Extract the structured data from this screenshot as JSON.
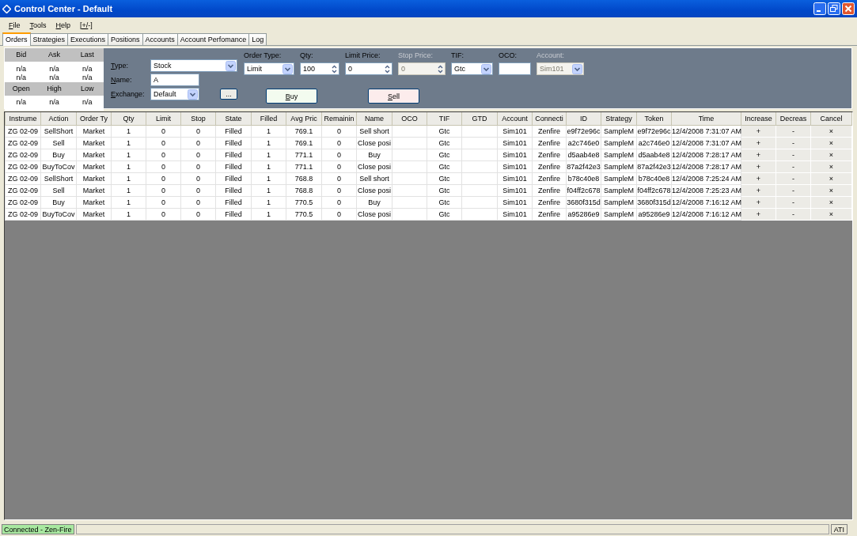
{
  "window": {
    "title": "Control Center - Default"
  },
  "menu": [
    {
      "label": "File"
    },
    {
      "label": "Tools"
    },
    {
      "label": "Help"
    },
    {
      "label": "[+/-]"
    }
  ],
  "tabs": [
    {
      "label": "Orders",
      "selected": true
    },
    {
      "label": "Strategies",
      "selected": false
    },
    {
      "label": "Executions",
      "selected": false
    },
    {
      "label": "Positions",
      "selected": false
    },
    {
      "label": "Accounts",
      "selected": false
    },
    {
      "label": "Account Perfomance",
      "selected": false
    },
    {
      "label": "Log",
      "selected": false
    }
  ],
  "quote": {
    "headers_top": [
      "Bid",
      "Ask",
      "Last"
    ],
    "values_top": [
      [
        "n/a",
        "n/a",
        "n/a"
      ],
      [
        "n/a",
        "n/a",
        "n/a"
      ]
    ],
    "headers_bottom": [
      "Open",
      "High",
      "Low"
    ],
    "values_bottom": [
      "n/a",
      "n/a",
      "n/a"
    ]
  },
  "instrument": [
    {
      "label": "Type:",
      "kind": "dropdown",
      "value": "Stock"
    },
    {
      "label": "Name:",
      "kind": "text",
      "value": "A"
    },
    {
      "label": "Exchange:",
      "kind": "dropdown",
      "value": "Default"
    }
  ],
  "browse_button": "...",
  "order_fields": [
    {
      "label": "Order Type:",
      "kind": "dropdown",
      "value": "Limit",
      "disabled": false
    },
    {
      "label": "Qty:",
      "kind": "spinner",
      "value": "100",
      "disabled": false
    },
    {
      "label": "Limit Price:",
      "kind": "spinner",
      "value": "0",
      "disabled": false
    },
    {
      "label": "Stop Price:",
      "kind": "spinner",
      "value": "0",
      "disabled": true
    },
    {
      "label": "TIF:",
      "kind": "dropdown",
      "value": "Gtc",
      "disabled": false
    },
    {
      "label": "OCO:",
      "kind": "text",
      "disabled": false
    },
    {
      "label": "Account:",
      "kind": "dropdown",
      "value": "Sim101",
      "disabled": true
    }
  ],
  "buttons": [
    {
      "label": "Buy",
      "kind": "buy"
    },
    {
      "label": "Sell",
      "kind": "sell"
    }
  ],
  "table": {
    "columns": [
      "Instrume",
      "Action",
      "Order Ty",
      "Qty",
      "Limit",
      "Stop",
      "State",
      "Filled",
      "Avg Pric",
      "Remainin",
      "Name",
      "OCO",
      "TIF",
      "GTD",
      "Account",
      "Connecti",
      "ID",
      "Strategy",
      "Token",
      "Time",
      "Increase",
      "Decreas",
      "Cancel"
    ],
    "rows": [
      [
        "ZG 02-09",
        "SellShort",
        "Market",
        "1",
        "0",
        "0",
        "Filled",
        "1",
        "769.1",
        "0",
        "Sell short",
        "",
        "Gtc",
        "",
        "Sim101",
        "Zenfire",
        "e9f72e96c",
        "SampleM",
        "e9f72e96c",
        "12/4/2008 7:31:07 AM",
        "+",
        "-",
        "×"
      ],
      [
        "ZG 02-09",
        "Sell",
        "Market",
        "1",
        "0",
        "0",
        "Filled",
        "1",
        "769.1",
        "0",
        "Close posi",
        "",
        "Gtc",
        "",
        "Sim101",
        "Zenfire",
        "a2c746e0",
        "SampleM",
        "a2c746e0",
        "12/4/2008 7:31:07 AM",
        "+",
        "-",
        "×"
      ],
      [
        "ZG 02-09",
        "Buy",
        "Market",
        "1",
        "0",
        "0",
        "Filled",
        "1",
        "771.1",
        "0",
        "Buy",
        "",
        "Gtc",
        "",
        "Sim101",
        "Zenfire",
        "d5aab4e8",
        "SampleM",
        "d5aab4e8",
        "12/4/2008 7:28:17 AM",
        "+",
        "-",
        "×"
      ],
      [
        "ZG 02-09",
        "BuyToCov",
        "Market",
        "1",
        "0",
        "0",
        "Filled",
        "1",
        "771.1",
        "0",
        "Close posi",
        "",
        "Gtc",
        "",
        "Sim101",
        "Zenfire",
        "87a2f42e3",
        "SampleM",
        "87a2f42e3",
        "12/4/2008 7:28:17 AM",
        "+",
        "-",
        "×"
      ],
      [
        "ZG 02-09",
        "SellShort",
        "Market",
        "1",
        "0",
        "0",
        "Filled",
        "1",
        "768.8",
        "0",
        "Sell short",
        "",
        "Gtc",
        "",
        "Sim101",
        "Zenfire",
        "b78c40e8",
        "SampleM",
        "b78c40e8",
        "12/4/2008 7:25:24 AM",
        "+",
        "-",
        "×"
      ],
      [
        "ZG 02-09",
        "Sell",
        "Market",
        "1",
        "0",
        "0",
        "Filled",
        "1",
        "768.8",
        "0",
        "Close posi",
        "",
        "Gtc",
        "",
        "Sim101",
        "Zenfire",
        "f04ff2c678",
        "SampleM",
        "f04ff2c678",
        "12/4/2008 7:25:23 AM",
        "+",
        "-",
        "×"
      ],
      [
        "ZG 02-09",
        "Buy",
        "Market",
        "1",
        "0",
        "0",
        "Filled",
        "1",
        "770.5",
        "0",
        "Buy",
        "",
        "Gtc",
        "",
        "Sim101",
        "Zenfire",
        "3680f315d",
        "SampleM",
        "3680f315d",
        "12/4/2008 7:16:12 AM",
        "+",
        "-",
        "×"
      ],
      [
        "ZG 02-09",
        "BuyToCov",
        "Market",
        "1",
        "0",
        "0",
        "Filled",
        "1",
        "770.5",
        "0",
        "Close posi",
        "",
        "Gtc",
        "",
        "Sim101",
        "Zenfire",
        "a95286e9",
        "SampleM",
        "a95286e9",
        "12/4/2008 7:16:12 AM",
        "+",
        "-",
        "×"
      ]
    ]
  },
  "status_bar": {
    "connection": "Connected - Zen-Fire",
    "right": "ATI"
  }
}
